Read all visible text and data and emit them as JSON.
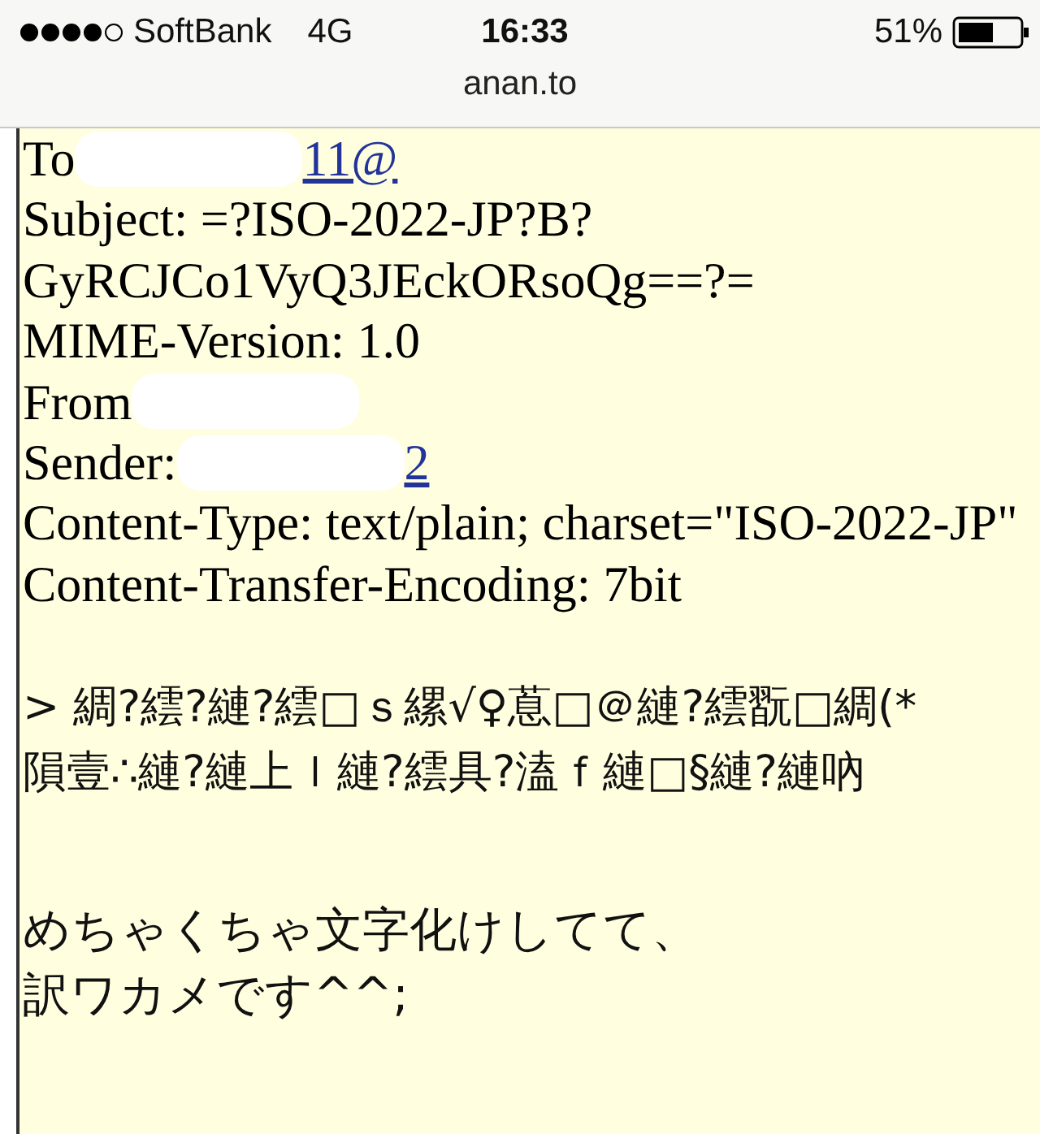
{
  "status_bar": {
    "carrier": "SoftBank",
    "network": "4G",
    "time": "16:33",
    "battery": "51%"
  },
  "address_bar": {
    "url": "anan.to"
  },
  "headers": [
    {
      "text": "To",
      "redacted": true,
      "link": "11@"
    },
    {
      "text": "Subject: =?ISO-2022-JP?B?",
      "redacted": false
    },
    {
      "text": "GyRCJCo1VyQ3JEckORsoQg==?=",
      "redacted": false
    },
    {
      "text": "MIME-Version: 1.0",
      "redacted": false
    },
    {
      "text": "From",
      "redacted": true
    },
    {
      "text": "Sender:",
      "redacted": true,
      "link": "2"
    },
    {
      "text": "Content-Type: text/plain; charset=\"ISO-2022-JP\"",
      "redacted": false
    },
    {
      "text": "Content-Transfer-Encoding: 7bit",
      "redacted": false
    }
  ],
  "garbled_lines": [
    "> 綢?繧?縺?繧□ｓ縲√♀蒠□＠縺?繧翫□綢(*",
    "隕壹∴縺?縺上ｌ縺?繧具?溘ｆ縺□§縺?縺吶"
  ],
  "message_lines": [
    "めちゃくちゃ文字化けしてて、",
    "訳ワカメです^^;"
  ]
}
